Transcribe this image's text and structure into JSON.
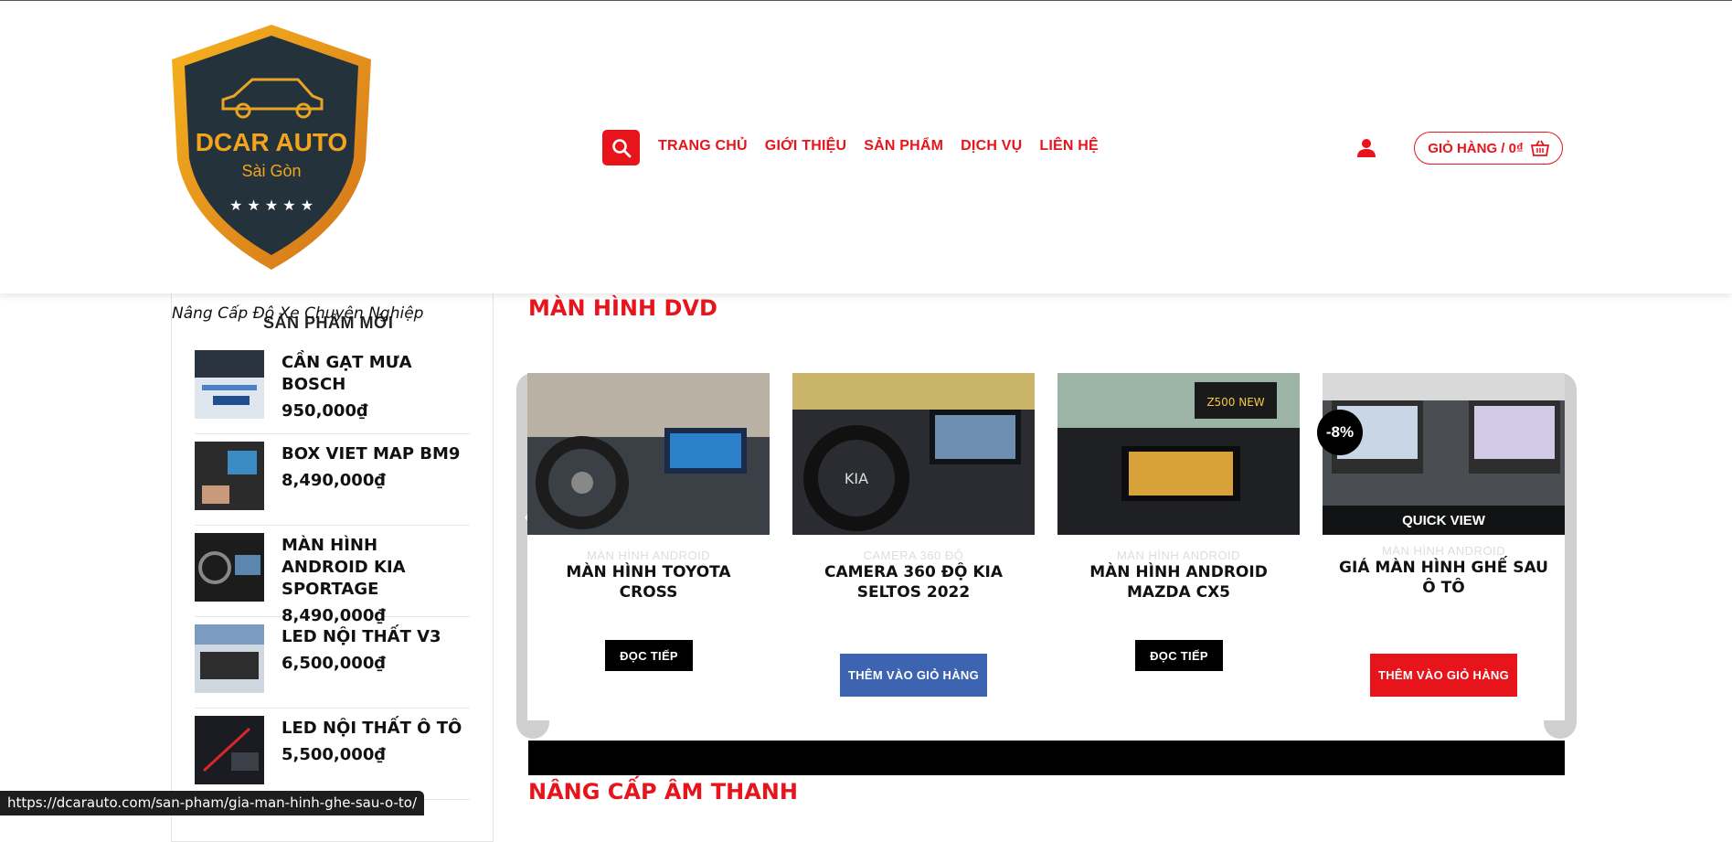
{
  "brand": {
    "logo_text": "DCAR AUTO",
    "logo_sub": "Sài Gòn",
    "colors": {
      "accent": "#e8141b",
      "logo_gold": "#e8a020",
      "logo_dark": "#24323c"
    }
  },
  "nav": {
    "items": [
      "TRANG CHỦ",
      "GIỚI THIỆU",
      "SẢN PHẨM",
      "DỊCH VỤ",
      "LIÊN HỆ"
    ],
    "search_icon": "search-icon",
    "user_icon": "user-icon",
    "cart_label": "GIỎ HÀNG / 0₫",
    "cart_icon": "basket-icon"
  },
  "tagline": "Nâng Cấp Độ Xe Chuyên Nghiệp",
  "sidebar": {
    "title": "SẢN PHẨM MỚI",
    "items": [
      {
        "name": "CẦN GẠT MƯA BOSCH",
        "price": "950,000₫"
      },
      {
        "name": "BOX VIET MAP BM9",
        "price": "8,490,000₫"
      },
      {
        "name": "MÀN HÌNH ANDROID KIA SPORTAGE",
        "price": "8,490,000₫"
      },
      {
        "name": "LED NỘI THẤT V3",
        "price": "6,500,000₫"
      },
      {
        "name": "LED NỘI THẤT Ô TÔ",
        "price": "5,500,000₫"
      }
    ]
  },
  "section_dvd": {
    "title": "MÀN HÌNH DVD",
    "products": [
      {
        "category": "MÀN HÌNH ANDROID",
        "title": "MÀN HÌNH TOYOTA CROSS",
        "button": "ĐỌC TIẾP"
      },
      {
        "category": "CAMERA 360 ĐỘ",
        "title": "CAMERA 360 ĐỘ KIA SELTOS 2022",
        "button": "THÊM VÀO GIỎ HÀNG"
      },
      {
        "category": "MÀN HÌNH ANDROID",
        "title": "MÀN HÌNH ANDROID MAZDA CX5",
        "button": "ĐỌC TIẾP"
      },
      {
        "category": "MÀN HÌNH ANDROID",
        "title": "GIÁ MÀN HÌNH GHẾ SAU Ô TÔ",
        "button": "THÊM VÀO GIỎ HÀNG",
        "badge": "-8%",
        "overlay": "QUICK VIEW"
      }
    ]
  },
  "section_audio": {
    "title": "NÂNG CẤP ÂM THANH"
  },
  "status_bar": {
    "url": "https://dcarauto.com/san-pham/gia-man-hinh-ghe-sau-o-to/"
  }
}
